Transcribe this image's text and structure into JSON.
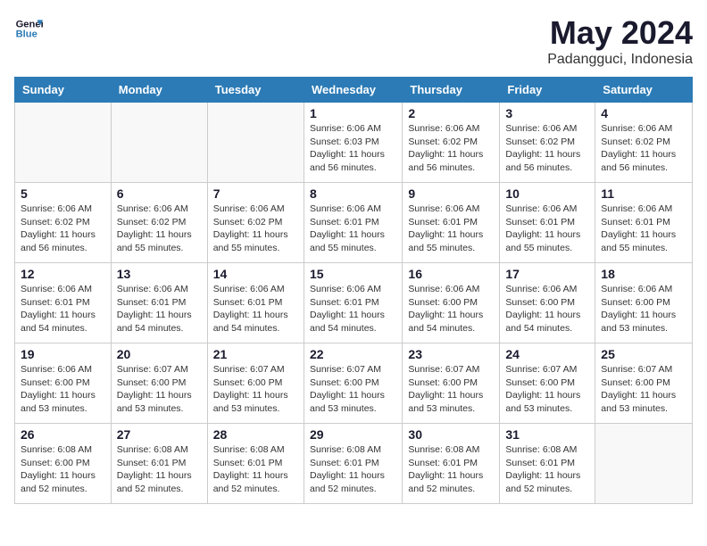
{
  "logo": {
    "line1": "General",
    "line2": "Blue"
  },
  "title": "May 2024",
  "location": "Padangguci, Indonesia",
  "weekdays": [
    "Sunday",
    "Monday",
    "Tuesday",
    "Wednesday",
    "Thursday",
    "Friday",
    "Saturday"
  ],
  "weeks": [
    [
      {
        "day": "",
        "info": ""
      },
      {
        "day": "",
        "info": ""
      },
      {
        "day": "",
        "info": ""
      },
      {
        "day": "1",
        "info": "Sunrise: 6:06 AM\nSunset: 6:03 PM\nDaylight: 11 hours\nand 56 minutes."
      },
      {
        "day": "2",
        "info": "Sunrise: 6:06 AM\nSunset: 6:02 PM\nDaylight: 11 hours\nand 56 minutes."
      },
      {
        "day": "3",
        "info": "Sunrise: 6:06 AM\nSunset: 6:02 PM\nDaylight: 11 hours\nand 56 minutes."
      },
      {
        "day": "4",
        "info": "Sunrise: 6:06 AM\nSunset: 6:02 PM\nDaylight: 11 hours\nand 56 minutes."
      }
    ],
    [
      {
        "day": "5",
        "info": "Sunrise: 6:06 AM\nSunset: 6:02 PM\nDaylight: 11 hours\nand 56 minutes."
      },
      {
        "day": "6",
        "info": "Sunrise: 6:06 AM\nSunset: 6:02 PM\nDaylight: 11 hours\nand 55 minutes."
      },
      {
        "day": "7",
        "info": "Sunrise: 6:06 AM\nSunset: 6:02 PM\nDaylight: 11 hours\nand 55 minutes."
      },
      {
        "day": "8",
        "info": "Sunrise: 6:06 AM\nSunset: 6:01 PM\nDaylight: 11 hours\nand 55 minutes."
      },
      {
        "day": "9",
        "info": "Sunrise: 6:06 AM\nSunset: 6:01 PM\nDaylight: 11 hours\nand 55 minutes."
      },
      {
        "day": "10",
        "info": "Sunrise: 6:06 AM\nSunset: 6:01 PM\nDaylight: 11 hours\nand 55 minutes."
      },
      {
        "day": "11",
        "info": "Sunrise: 6:06 AM\nSunset: 6:01 PM\nDaylight: 11 hours\nand 55 minutes."
      }
    ],
    [
      {
        "day": "12",
        "info": "Sunrise: 6:06 AM\nSunset: 6:01 PM\nDaylight: 11 hours\nand 54 minutes."
      },
      {
        "day": "13",
        "info": "Sunrise: 6:06 AM\nSunset: 6:01 PM\nDaylight: 11 hours\nand 54 minutes."
      },
      {
        "day": "14",
        "info": "Sunrise: 6:06 AM\nSunset: 6:01 PM\nDaylight: 11 hours\nand 54 minutes."
      },
      {
        "day": "15",
        "info": "Sunrise: 6:06 AM\nSunset: 6:01 PM\nDaylight: 11 hours\nand 54 minutes."
      },
      {
        "day": "16",
        "info": "Sunrise: 6:06 AM\nSunset: 6:00 PM\nDaylight: 11 hours\nand 54 minutes."
      },
      {
        "day": "17",
        "info": "Sunrise: 6:06 AM\nSunset: 6:00 PM\nDaylight: 11 hours\nand 54 minutes."
      },
      {
        "day": "18",
        "info": "Sunrise: 6:06 AM\nSunset: 6:00 PM\nDaylight: 11 hours\nand 53 minutes."
      }
    ],
    [
      {
        "day": "19",
        "info": "Sunrise: 6:06 AM\nSunset: 6:00 PM\nDaylight: 11 hours\nand 53 minutes."
      },
      {
        "day": "20",
        "info": "Sunrise: 6:07 AM\nSunset: 6:00 PM\nDaylight: 11 hours\nand 53 minutes."
      },
      {
        "day": "21",
        "info": "Sunrise: 6:07 AM\nSunset: 6:00 PM\nDaylight: 11 hours\nand 53 minutes."
      },
      {
        "day": "22",
        "info": "Sunrise: 6:07 AM\nSunset: 6:00 PM\nDaylight: 11 hours\nand 53 minutes."
      },
      {
        "day": "23",
        "info": "Sunrise: 6:07 AM\nSunset: 6:00 PM\nDaylight: 11 hours\nand 53 minutes."
      },
      {
        "day": "24",
        "info": "Sunrise: 6:07 AM\nSunset: 6:00 PM\nDaylight: 11 hours\nand 53 minutes."
      },
      {
        "day": "25",
        "info": "Sunrise: 6:07 AM\nSunset: 6:00 PM\nDaylight: 11 hours\nand 53 minutes."
      }
    ],
    [
      {
        "day": "26",
        "info": "Sunrise: 6:08 AM\nSunset: 6:00 PM\nDaylight: 11 hours\nand 52 minutes."
      },
      {
        "day": "27",
        "info": "Sunrise: 6:08 AM\nSunset: 6:01 PM\nDaylight: 11 hours\nand 52 minutes."
      },
      {
        "day": "28",
        "info": "Sunrise: 6:08 AM\nSunset: 6:01 PM\nDaylight: 11 hours\nand 52 minutes."
      },
      {
        "day": "29",
        "info": "Sunrise: 6:08 AM\nSunset: 6:01 PM\nDaylight: 11 hours\nand 52 minutes."
      },
      {
        "day": "30",
        "info": "Sunrise: 6:08 AM\nSunset: 6:01 PM\nDaylight: 11 hours\nand 52 minutes."
      },
      {
        "day": "31",
        "info": "Sunrise: 6:08 AM\nSunset: 6:01 PM\nDaylight: 11 hours\nand 52 minutes."
      },
      {
        "day": "",
        "info": ""
      }
    ]
  ]
}
